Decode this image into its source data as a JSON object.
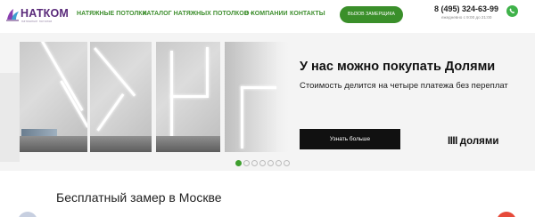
{
  "header": {
    "logo_text": "НАТКОМ",
    "logo_sub": "натяжные потолки",
    "nav": [
      {
        "label": "Натяжные потолки"
      },
      {
        "label": "Каталог натяжных потолков"
      },
      {
        "label": "О компании"
      },
      {
        "label": "Контакты"
      }
    ],
    "cta_label": "Вызов замерщика",
    "phone": "8 (495) 324-63-99",
    "hours": "ежедневно с 9:00 до 21:00",
    "whatsapp_icon": "whatsapp-icon"
  },
  "hero": {
    "title": "У нас можно покупать Долями",
    "subtitle": "Стоимость делится на четыре платежа без переплат",
    "button_label": "Узнать больше",
    "brand_mark": "IIII",
    "brand_name": "долями",
    "slides_total": 7,
    "slide_active": 1
  },
  "section": {
    "title": "Бесплатный замер в Москве"
  },
  "colors": {
    "accent": "#3a8f2a",
    "nav_text": "#3f8f2f",
    "logo": "#5a2a7a",
    "button_dark": "#111111"
  }
}
